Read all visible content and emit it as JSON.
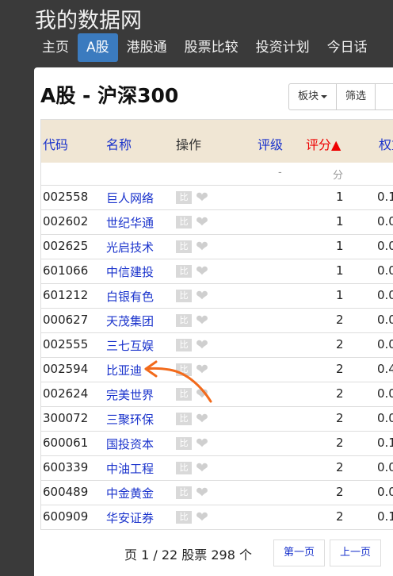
{
  "site": {
    "title": "我的数据网"
  },
  "nav": {
    "items": [
      "主页",
      "A股",
      "港股通",
      "股票比较",
      "投资计划",
      "今日话"
    ]
  },
  "page": {
    "title": "A股 - 沪深300"
  },
  "toolbar": {
    "sector_label": "板块",
    "filter_label": "筛选"
  },
  "table": {
    "headers": {
      "code": "代码",
      "name": "名称",
      "op": "操作",
      "rating": "评级",
      "score": "评分▲",
      "weight": "权重"
    },
    "units": {
      "rating": "-",
      "score": "分"
    },
    "compare_label": "比",
    "rows": [
      {
        "code": "002558",
        "name": "巨人网络",
        "score": "1",
        "weight": "0.1"
      },
      {
        "code": "002602",
        "name": "世纪华通",
        "score": "1",
        "weight": "0.0"
      },
      {
        "code": "002625",
        "name": "光启技术",
        "score": "1",
        "weight": "0.0"
      },
      {
        "code": "601066",
        "name": "中信建投",
        "score": "1",
        "weight": "0.0"
      },
      {
        "code": "601212",
        "name": "白银有色",
        "score": "1",
        "weight": "0.0"
      },
      {
        "code": "000627",
        "name": "天茂集团",
        "score": "2",
        "weight": "0.0"
      },
      {
        "code": "002555",
        "name": "三七互娱",
        "score": "2",
        "weight": "0.0"
      },
      {
        "code": "002594",
        "name": "比亚迪",
        "score": "2",
        "weight": "0.4"
      },
      {
        "code": "002624",
        "name": "完美世界",
        "score": "2",
        "weight": "0.0"
      },
      {
        "code": "300072",
        "name": "三聚环保",
        "score": "2",
        "weight": "0.0"
      },
      {
        "code": "600061",
        "name": "国投资本",
        "score": "2",
        "weight": "0.1"
      },
      {
        "code": "600339",
        "name": "中油工程",
        "score": "2",
        "weight": "0.0"
      },
      {
        "code": "600489",
        "name": "中金黄金",
        "score": "2",
        "weight": "0.0"
      },
      {
        "code": "600909",
        "name": "华安证券",
        "score": "2",
        "weight": "0.1"
      }
    ]
  },
  "pager": {
    "info": "页 1 / 22 股票 298 个",
    "first_label": "第一页",
    "prev_label": "上一页"
  },
  "colors": {
    "annotation": "#f26a1b",
    "link": "#1a33cc",
    "active_nav": "#3b7bbf",
    "header_bg": "#f0e6d4"
  }
}
